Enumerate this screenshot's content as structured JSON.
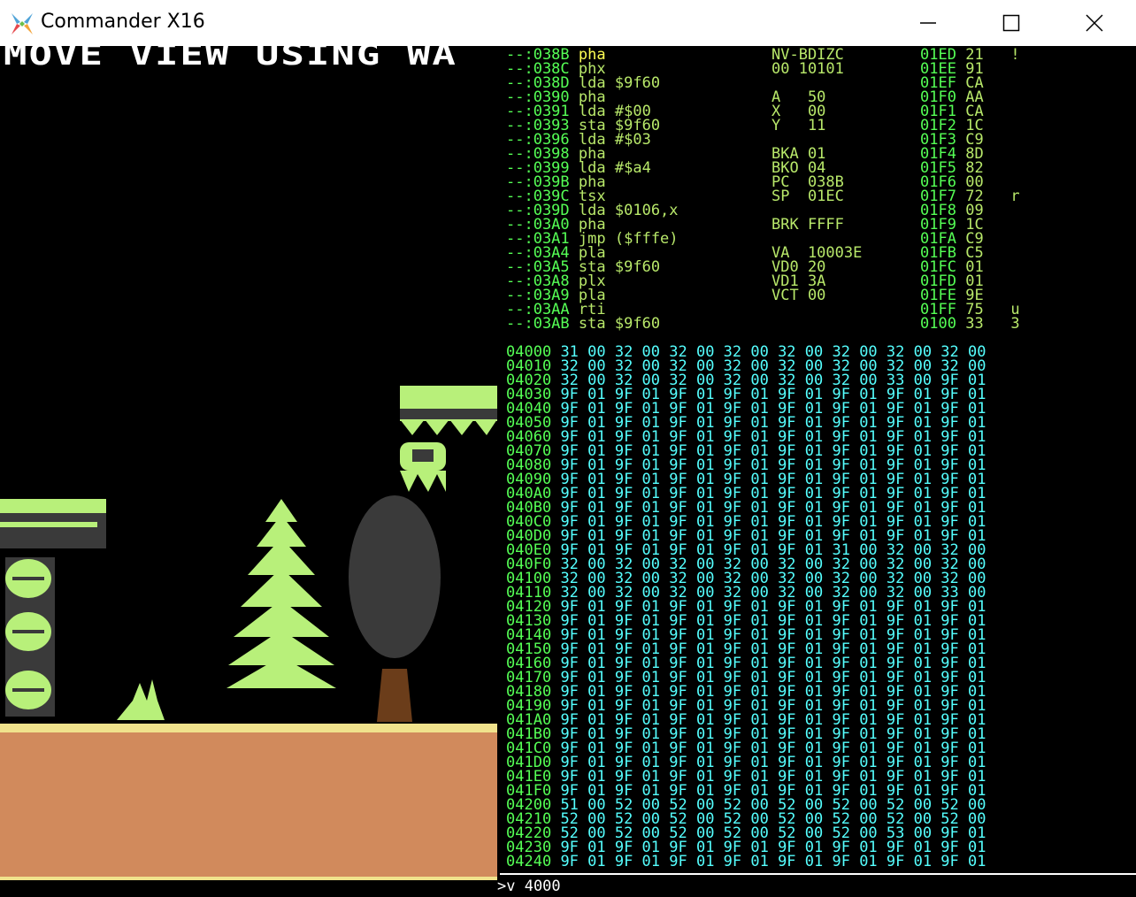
{
  "window": {
    "title": "Commander X16",
    "icon": "x16-logo-icon"
  },
  "game": {
    "banner": "MOVE VIEW USING WA"
  },
  "disasm": [
    {
      "a": "--:038B",
      "op": "pha",
      "arg": "",
      "cur": true
    },
    {
      "a": "--:038C",
      "op": "phx",
      "arg": ""
    },
    {
      "a": "--:038D",
      "op": "lda",
      "arg": "$9f60"
    },
    {
      "a": "--:0390",
      "op": "pha",
      "arg": ""
    },
    {
      "a": "--:0391",
      "op": "lda",
      "arg": "#$00"
    },
    {
      "a": "--:0393",
      "op": "sta",
      "arg": "$9f60"
    },
    {
      "a": "--:0396",
      "op": "lda",
      "arg": "#$03"
    },
    {
      "a": "--:0398",
      "op": "pha",
      "arg": ""
    },
    {
      "a": "--:0399",
      "op": "lda",
      "arg": "#$a4"
    },
    {
      "a": "--:039B",
      "op": "pha",
      "arg": ""
    },
    {
      "a": "--:039C",
      "op": "tsx",
      "arg": ""
    },
    {
      "a": "--:039D",
      "op": "lda",
      "arg": "$0106,x"
    },
    {
      "a": "--:03A0",
      "op": "pha",
      "arg": ""
    },
    {
      "a": "--:03A1",
      "op": "jmp",
      "arg": "($fffe)"
    },
    {
      "a": "--:03A4",
      "op": "pla",
      "arg": ""
    },
    {
      "a": "--:03A5",
      "op": "sta",
      "arg": "$9f60"
    },
    {
      "a": "--:03A8",
      "op": "plx",
      "arg": ""
    },
    {
      "a": "--:03A9",
      "op": "pla",
      "arg": ""
    },
    {
      "a": "--:03AA",
      "op": "rti",
      "arg": ""
    },
    {
      "a": "--:03AB",
      "op": "sta",
      "arg": "$9f60"
    }
  ],
  "regs": [
    "NV-BDIZC",
    "00 10101",
    "",
    "A   50",
    "X   00",
    "Y   11",
    "",
    "BKA 01",
    "BKO 04",
    "PC  038B",
    "SP  01EC",
    "",
    "BRK FFFF",
    "",
    "VA  10003E",
    "VD0 20",
    "VD1 3A",
    "VCT 00"
  ],
  "stack": [
    {
      "a": "01ED",
      "v": "21",
      "c": "!"
    },
    {
      "a": "01EE",
      "v": "91",
      "c": ""
    },
    {
      "a": "01EF",
      "v": "CA",
      "c": ""
    },
    {
      "a": "01F0",
      "v": "AA",
      "c": ""
    },
    {
      "a": "01F1",
      "v": "CA",
      "c": ""
    },
    {
      "a": "01F2",
      "v": "1C",
      "c": ""
    },
    {
      "a": "01F3",
      "v": "C9",
      "c": ""
    },
    {
      "a": "01F4",
      "v": "8D",
      "c": ""
    },
    {
      "a": "01F5",
      "v": "82",
      "c": ""
    },
    {
      "a": "01F6",
      "v": "00",
      "c": ""
    },
    {
      "a": "01F7",
      "v": "72",
      "c": "r"
    },
    {
      "a": "01F8",
      "v": "09",
      "c": ""
    },
    {
      "a": "01F9",
      "v": "1C",
      "c": ""
    },
    {
      "a": "01FA",
      "v": "C9",
      "c": ""
    },
    {
      "a": "01FB",
      "v": "C5",
      "c": ""
    },
    {
      "a": "01FC",
      "v": "01",
      "c": ""
    },
    {
      "a": "01FD",
      "v": "01",
      "c": ""
    },
    {
      "a": "01FE",
      "v": "9E",
      "c": ""
    },
    {
      "a": "01FF",
      "v": "75",
      "c": "u"
    },
    {
      "a": "0100",
      "v": "33",
      "c": "3"
    }
  ],
  "memory": [
    {
      "a": "04000",
      "b": "31 00 32 00 32 00 32 00 32 00 32 00 32 00 32 00"
    },
    {
      "a": "04010",
      "b": "32 00 32 00 32 00 32 00 32 00 32 00 32 00 32 00"
    },
    {
      "a": "04020",
      "b": "32 00 32 00 32 00 32 00 32 00 32 00 33 00 9F 01"
    },
    {
      "a": "04030",
      "b": "9F 01 9F 01 9F 01 9F 01 9F 01 9F 01 9F 01 9F 01"
    },
    {
      "a": "04040",
      "b": "9F 01 9F 01 9F 01 9F 01 9F 01 9F 01 9F 01 9F 01"
    },
    {
      "a": "04050",
      "b": "9F 01 9F 01 9F 01 9F 01 9F 01 9F 01 9F 01 9F 01"
    },
    {
      "a": "04060",
      "b": "9F 01 9F 01 9F 01 9F 01 9F 01 9F 01 9F 01 9F 01"
    },
    {
      "a": "04070",
      "b": "9F 01 9F 01 9F 01 9F 01 9F 01 9F 01 9F 01 9F 01"
    },
    {
      "a": "04080",
      "b": "9F 01 9F 01 9F 01 9F 01 9F 01 9F 01 9F 01 9F 01"
    },
    {
      "a": "04090",
      "b": "9F 01 9F 01 9F 01 9F 01 9F 01 9F 01 9F 01 9F 01"
    },
    {
      "a": "040A0",
      "b": "9F 01 9F 01 9F 01 9F 01 9F 01 9F 01 9F 01 9F 01"
    },
    {
      "a": "040B0",
      "b": "9F 01 9F 01 9F 01 9F 01 9F 01 9F 01 9F 01 9F 01"
    },
    {
      "a": "040C0",
      "b": "9F 01 9F 01 9F 01 9F 01 9F 01 9F 01 9F 01 9F 01"
    },
    {
      "a": "040D0",
      "b": "9F 01 9F 01 9F 01 9F 01 9F 01 9F 01 9F 01 9F 01"
    },
    {
      "a": "040E0",
      "b": "9F 01 9F 01 9F 01 9F 01 9F 01 31 00 32 00 32 00"
    },
    {
      "a": "040F0",
      "b": "32 00 32 00 32 00 32 00 32 00 32 00 32 00 32 00"
    },
    {
      "a": "04100",
      "b": "32 00 32 00 32 00 32 00 32 00 32 00 32 00 32 00"
    },
    {
      "a": "04110",
      "b": "32 00 32 00 32 00 32 00 32 00 32 00 32 00 33 00"
    },
    {
      "a": "04120",
      "b": "9F 01 9F 01 9F 01 9F 01 9F 01 9F 01 9F 01 9F 01"
    },
    {
      "a": "04130",
      "b": "9F 01 9F 01 9F 01 9F 01 9F 01 9F 01 9F 01 9F 01"
    },
    {
      "a": "04140",
      "b": "9F 01 9F 01 9F 01 9F 01 9F 01 9F 01 9F 01 9F 01"
    },
    {
      "a": "04150",
      "b": "9F 01 9F 01 9F 01 9F 01 9F 01 9F 01 9F 01 9F 01"
    },
    {
      "a": "04160",
      "b": "9F 01 9F 01 9F 01 9F 01 9F 01 9F 01 9F 01 9F 01"
    },
    {
      "a": "04170",
      "b": "9F 01 9F 01 9F 01 9F 01 9F 01 9F 01 9F 01 9F 01"
    },
    {
      "a": "04180",
      "b": "9F 01 9F 01 9F 01 9F 01 9F 01 9F 01 9F 01 9F 01"
    },
    {
      "a": "04190",
      "b": "9F 01 9F 01 9F 01 9F 01 9F 01 9F 01 9F 01 9F 01"
    },
    {
      "a": "041A0",
      "b": "9F 01 9F 01 9F 01 9F 01 9F 01 9F 01 9F 01 9F 01"
    },
    {
      "a": "041B0",
      "b": "9F 01 9F 01 9F 01 9F 01 9F 01 9F 01 9F 01 9F 01"
    },
    {
      "a": "041C0",
      "b": "9F 01 9F 01 9F 01 9F 01 9F 01 9F 01 9F 01 9F 01"
    },
    {
      "a": "041D0",
      "b": "9F 01 9F 01 9F 01 9F 01 9F 01 9F 01 9F 01 9F 01"
    },
    {
      "a": "041E0",
      "b": "9F 01 9F 01 9F 01 9F 01 9F 01 9F 01 9F 01 9F 01"
    },
    {
      "a": "041F0",
      "b": "9F 01 9F 01 9F 01 9F 01 9F 01 9F 01 9F 01 9F 01"
    },
    {
      "a": "04200",
      "b": "51 00 52 00 52 00 52 00 52 00 52 00 52 00 52 00"
    },
    {
      "a": "04210",
      "b": "52 00 52 00 52 00 52 00 52 00 52 00 52 00 52 00"
    },
    {
      "a": "04220",
      "b": "52 00 52 00 52 00 52 00 52 00 52 00 53 00 9F 01"
    },
    {
      "a": "04230",
      "b": "9F 01 9F 01 9F 01 9F 01 9F 01 9F 01 9F 01 9F 01"
    },
    {
      "a": "04240",
      "b": "9F 01 9F 01 9F 01 9F 01 9F 01 9F 01 9F 01 9F 01"
    }
  ],
  "command": ">v 4000",
  "colors": {
    "address": "#55ff55",
    "code": "#b8e86a",
    "current": "#ffff55",
    "memory": "#55ffff",
    "ground": "#d18a5c",
    "ground_edge": "#f0e28c",
    "foliage": "#b8f07a",
    "trunk": "#6b3d1a",
    "shadow_tree": "#3a3a3a"
  }
}
